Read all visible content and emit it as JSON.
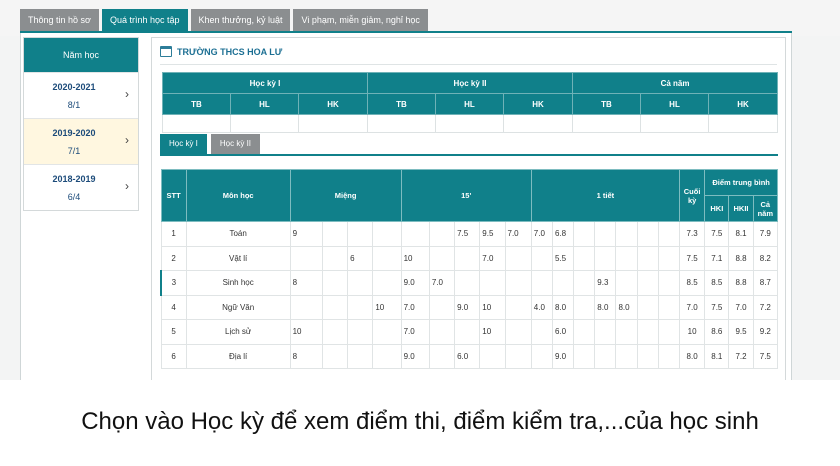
{
  "tabs": [
    "Thông tin hồ sơ",
    "Quá trình học tập",
    "Khen thưởng, kỷ luật",
    "Vi phạm, miễn giảm, nghỉ học"
  ],
  "active_tab": 1,
  "years": {
    "header": "Năm học",
    "items": [
      {
        "year": "2020-2021",
        "grade": "8/1"
      },
      {
        "year": "2019-2020",
        "grade": "7/1"
      },
      {
        "year": "2018-2019",
        "grade": "6/4"
      }
    ]
  },
  "school_name": "TRƯỜNG THCS HOA LƯ",
  "summary": {
    "groups": [
      "Học kỳ I",
      "Học kỳ II",
      "Cả năm"
    ],
    "sub": [
      "TB",
      "HL",
      "HK",
      "TB",
      "HL",
      "HK",
      "TB",
      "HL",
      "HK"
    ]
  },
  "semester_tabs": [
    "Học kỳ I",
    "Học kỳ II"
  ],
  "grades": {
    "headers": {
      "stt": "STT",
      "subject": "Môn học",
      "mieng": "Miệng",
      "m15": "15'",
      "t1": "1 tiết",
      "cuoiky": "Cuối kỳ",
      "dtb": "Điểm trung bình",
      "hki": "HKI",
      "hkii": "HKII",
      "canam": "Cả năm"
    },
    "rows": [
      {
        "stt": "1",
        "subject": "Toán",
        "cells": [
          "9",
          "",
          "",
          "",
          "",
          "",
          "7.5",
          "9.5",
          "7.0",
          "7.0",
          "6.8",
          "",
          "",
          "",
          "",
          "",
          "7.3",
          "7.5",
          "8.1",
          "7.9"
        ]
      },
      {
        "stt": "2",
        "subject": "Vật lí",
        "cells": [
          "",
          "",
          "6",
          "",
          "10",
          "",
          "",
          "7.0",
          "",
          "",
          "5.5",
          "",
          "",
          "",
          "",
          "",
          "7.5",
          "7.1",
          "8.8",
          "8.2"
        ]
      },
      {
        "stt": "3",
        "subject": "Sinh học",
        "cells": [
          "8",
          "",
          "",
          "",
          "9.0",
          "7.0",
          "",
          "",
          "",
          "",
          "",
          "",
          "9.3",
          "",
          "",
          "",
          "8.5",
          "8.5",
          "8.8",
          "8.7"
        ]
      },
      {
        "stt": "4",
        "subject": "Ngữ Văn",
        "cells": [
          "",
          "",
          "",
          "10",
          "7.0",
          "",
          "9.0",
          "10",
          "",
          "4.0",
          "8.0",
          "",
          "8.0",
          "8.0",
          "",
          "",
          "7.0",
          "7.5",
          "7.0",
          "7.2"
        ]
      },
      {
        "stt": "5",
        "subject": "Lịch sử",
        "cells": [
          "10",
          "",
          "",
          "",
          "7.0",
          "",
          "",
          "10",
          "",
          "",
          "6.0",
          "",
          "",
          "",
          "",
          "",
          "10",
          "8.6",
          "9.5",
          "9.2"
        ]
      },
      {
        "stt": "6",
        "subject": "Địa lí",
        "cells": [
          "8",
          "",
          "",
          "",
          "9.0",
          "",
          "6.0",
          "",
          "",
          "",
          "9.0",
          "",
          "",
          "",
          "",
          "",
          "8.0",
          "8.1",
          "7.2",
          "7.5"
        ]
      }
    ]
  },
  "caption": "Chọn vào Học kỳ để xem điểm thi, điểm kiểm tra,...của học sinh"
}
